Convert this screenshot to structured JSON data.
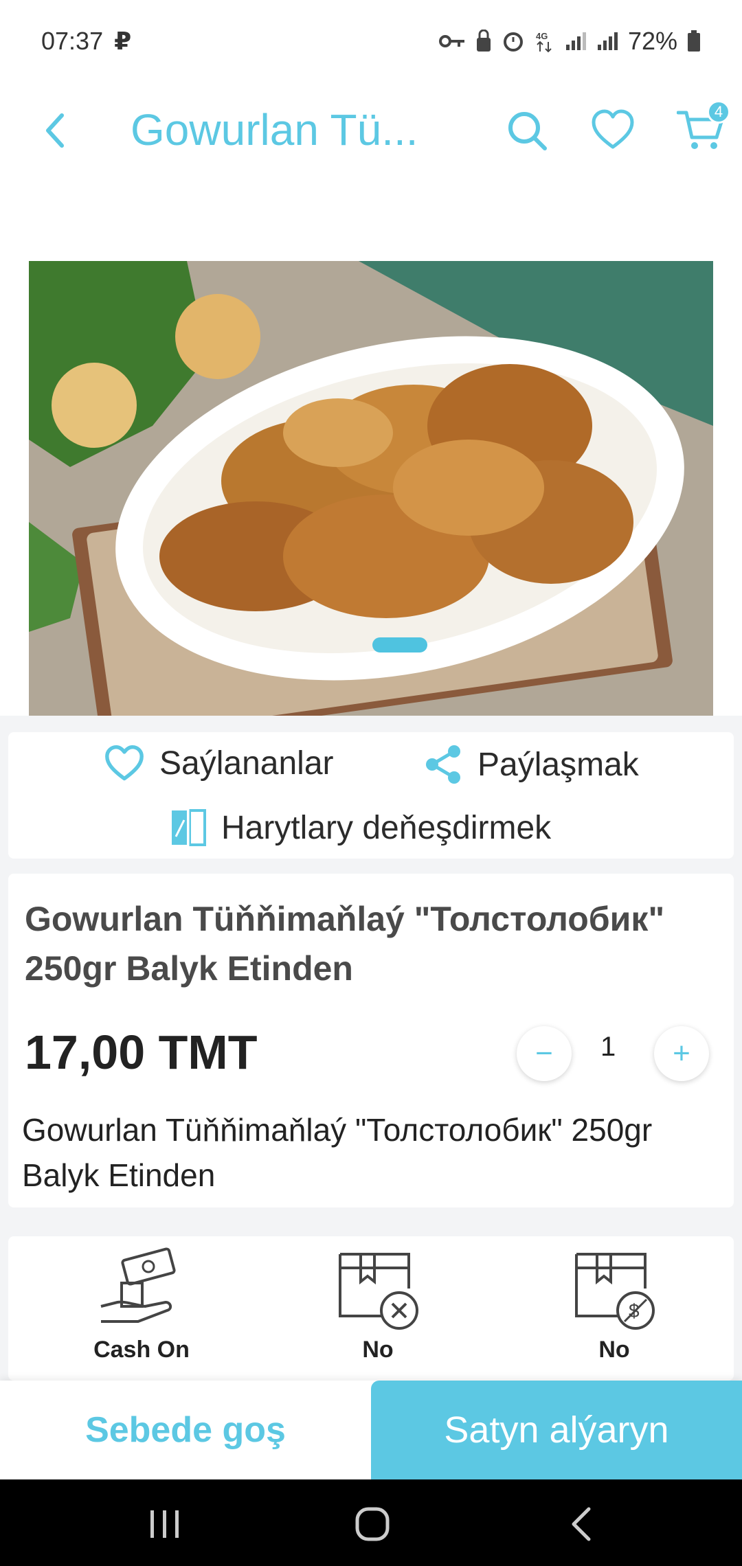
{
  "status": {
    "time": "07:37",
    "carrier_glyph": "₽",
    "battery": "72%"
  },
  "header": {
    "title": "Gowurlan Tü...",
    "cart_count": "4"
  },
  "actions": {
    "favorites": "Saýlananlar",
    "share": "Paýlaşmak",
    "compare": "Harytlary deňeşdirmek"
  },
  "product": {
    "name": "Gowurlan Tüňňimaňlaý \"Толстолобик\" 250gr Balyk Etinden",
    "price": "17,00 TMT",
    "quantity": "1",
    "minus": "−",
    "plus": "+",
    "description": "Gowurlan Tüňňimaňlaý \"Толстолобик\" 250gr Balyk Etinden"
  },
  "features": [
    {
      "label": "Cash On",
      "icon": "cash-on-delivery-icon"
    },
    {
      "label": "No",
      "icon": "no-cancel-icon"
    },
    {
      "label": "No",
      "icon": "no-refund-icon"
    }
  ],
  "bottom": {
    "add_to_cart": "Sebede goş",
    "buy": "Satyn alýaryn"
  },
  "colors": {
    "accent": "#5cc8e3",
    "background": "#f3f4f6"
  }
}
